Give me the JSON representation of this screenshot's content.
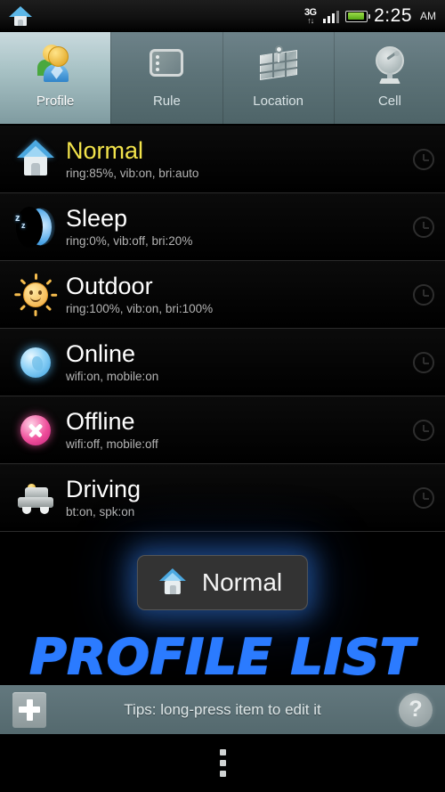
{
  "statusbar": {
    "home_icon": "home-icon",
    "network_label": "3G",
    "network_arrows": "↑↓",
    "signal_icon": "signal-bars-icon",
    "battery_icon": "battery-icon",
    "time": "2:25",
    "ampm": "AM"
  },
  "tabs": [
    {
      "label": "Profile",
      "icon": "profile-people-icon",
      "active": true
    },
    {
      "label": "Rule",
      "icon": "rule-list-icon",
      "active": false
    },
    {
      "label": "Location",
      "icon": "location-map-pin-icon",
      "active": false
    },
    {
      "label": "Cell",
      "icon": "cell-satellite-dish-icon",
      "active": false
    }
  ],
  "profiles": [
    {
      "title": "Normal",
      "sub": "ring:85%, vib:on, bri:auto",
      "icon": "home-icon",
      "active": true,
      "schedule_icon": "clock-icon"
    },
    {
      "title": "Sleep",
      "sub": "ring:0%, vib:off, bri:20%",
      "icon": "moon-icon",
      "active": false,
      "schedule_icon": "clock-icon"
    },
    {
      "title": "Outdoor",
      "sub": "ring:100%, vib:on, bri:100%",
      "icon": "sun-icon",
      "active": false,
      "schedule_icon": "clock-icon"
    },
    {
      "title": "Online",
      "sub": "wifi:on, mobile:on",
      "icon": "globe-icon",
      "active": false,
      "schedule_icon": "clock-icon"
    },
    {
      "title": "Offline",
      "sub": "wifi:off, mobile:off",
      "icon": "x-circle-icon",
      "active": false,
      "schedule_icon": "clock-icon"
    },
    {
      "title": "Driving",
      "sub": "bt:on, spk:on",
      "icon": "car-icon",
      "active": false,
      "schedule_icon": "clock-icon"
    }
  ],
  "toast": {
    "label": "Normal",
    "icon": "home-icon"
  },
  "overlay": {
    "title": "PROFILE LIST"
  },
  "bottombar": {
    "add_icon": "plus-icon",
    "tips": "Tips: long-press item to edit it",
    "help_label": "?"
  },
  "navbar": {
    "overflow_icon": "overflow-menu-icon"
  },
  "colors": {
    "accent_yellow": "#f2e34b",
    "overlay_blue": "#2b7bff",
    "tab_active_bg": "#a9c3c6",
    "battery_green": "#7fcf2e"
  }
}
